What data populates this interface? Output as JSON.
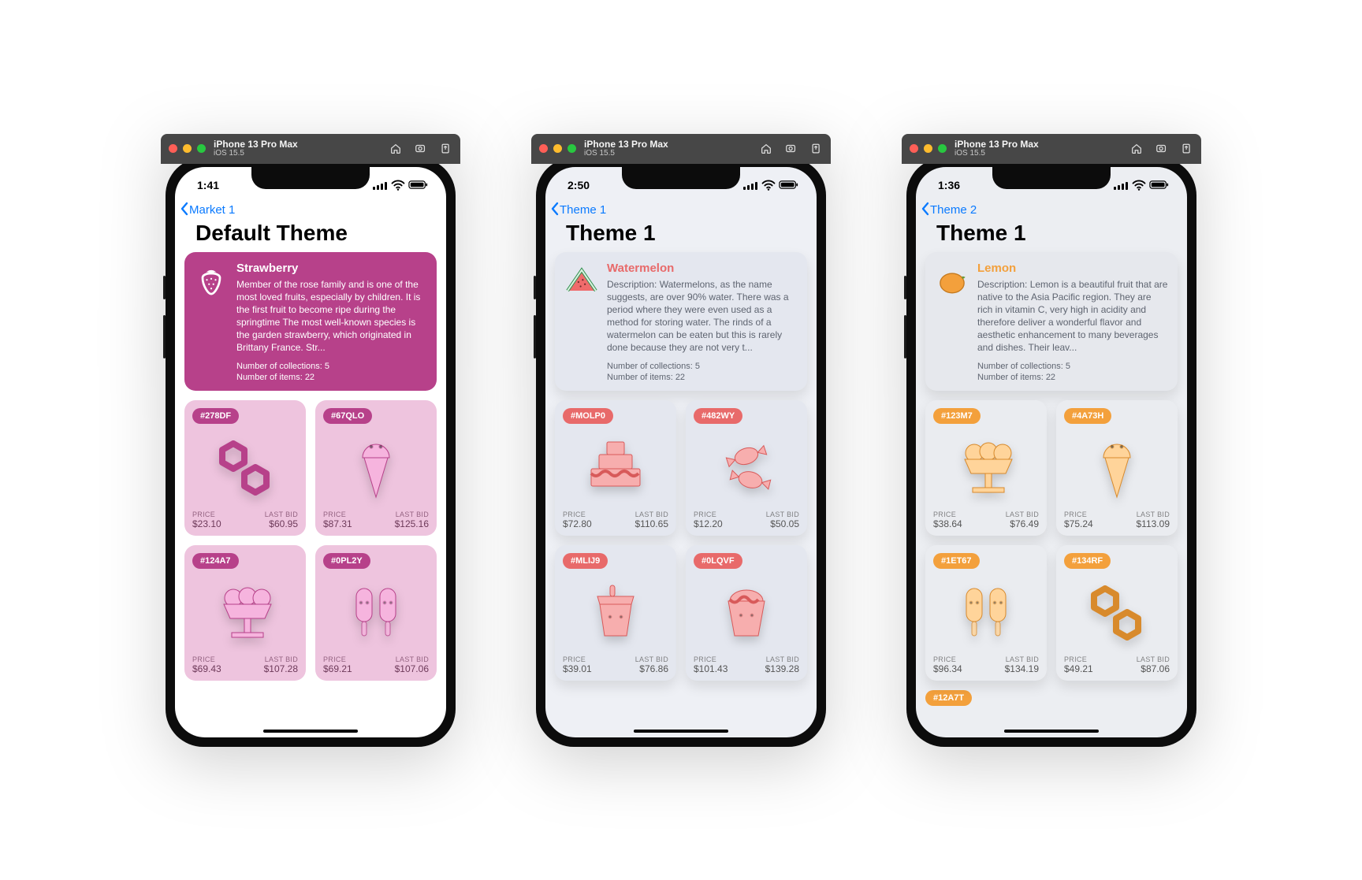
{
  "simulator": {
    "device": "iPhone 13 Pro Max",
    "os": "iOS 15.5"
  },
  "labels": {
    "price": "PRICE",
    "lastBid": "LAST BID",
    "collections": "Number of collections:",
    "items": "Number of items:"
  },
  "phones": [
    {
      "variant": "pink",
      "status": {
        "time": "1:41"
      },
      "nav": {
        "back": "Market 1"
      },
      "title": "Default Theme",
      "hero": {
        "name": "Strawberry",
        "desc": "Member of the rose family and is one of the most loved fruits, especially by children.  It is the first fruit to become ripe during the springtime The most well-known species is the garden strawberry, which originated in Brittany France.  Str...",
        "collections": 5,
        "items": 22,
        "icon": "strawberry"
      },
      "cards": [
        {
          "tag": "#278DF",
          "icon": "hex-rings",
          "price": "$23.10",
          "lastBid": "$60.95"
        },
        {
          "tag": "#67QLO",
          "icon": "cone",
          "price": "$87.31",
          "lastBid": "$125.16"
        },
        {
          "tag": "#124A7",
          "icon": "sundae",
          "price": "$69.43",
          "lastBid": "$107.28"
        },
        {
          "tag": "#0PL2Y",
          "icon": "popsicles",
          "price": "$69.21",
          "lastBid": "$107.06"
        }
      ]
    },
    {
      "variant": "salmon",
      "status": {
        "time": "2:50"
      },
      "nav": {
        "back": "Theme 1"
      },
      "title": "Theme 1",
      "hero": {
        "name": "Watermelon",
        "desc": "Description: Watermelons, as the name suggests, are over 90% water.  There was a period where they were even used as a method for storing water.  The rinds of a watermelon can be eaten but this is rarely done because they are not very t...",
        "collections": 5,
        "items": 22,
        "icon": "watermelon"
      },
      "cards": [
        {
          "tag": "#MOLP0",
          "icon": "cake",
          "price": "$72.80",
          "lastBid": "$110.65"
        },
        {
          "tag": "#482WY",
          "icon": "candies",
          "price": "$12.20",
          "lastBid": "$50.05"
        },
        {
          "tag": "#MLIJ9",
          "icon": "cup",
          "price": "$39.01",
          "lastBid": "$76.86"
        },
        {
          "tag": "#0LQVF",
          "icon": "icecream",
          "price": "$101.43",
          "lastBid": "$139.28"
        }
      ]
    },
    {
      "variant": "orange",
      "status": {
        "time": "1:36"
      },
      "nav": {
        "back": "Theme 2"
      },
      "title": "Theme 1",
      "hero": {
        "name": "Lemon",
        "desc": "Description: Lemon is a beautiful fruit that are native to the Asia Pacific region.  They are rich in vitamin C, very high in acidity and therefore deliver a wonderful flavor and aesthetic enhancement to many beverages and dishes.  Their leav...",
        "collections": 5,
        "items": 22,
        "icon": "lemon"
      },
      "cards": [
        {
          "tag": "#123M7",
          "icon": "sundae",
          "price": "$38.64",
          "lastBid": "$76.49"
        },
        {
          "tag": "#4A73H",
          "icon": "cone",
          "price": "$75.24",
          "lastBid": "$113.09"
        },
        {
          "tag": "#1ET67",
          "icon": "popsicles",
          "price": "$96.34",
          "lastBid": "$134.19"
        },
        {
          "tag": "#134RF",
          "icon": "hex-rings",
          "price": "$49.21",
          "lastBid": "$87.06"
        }
      ],
      "extraTag": "#12A7T"
    }
  ]
}
